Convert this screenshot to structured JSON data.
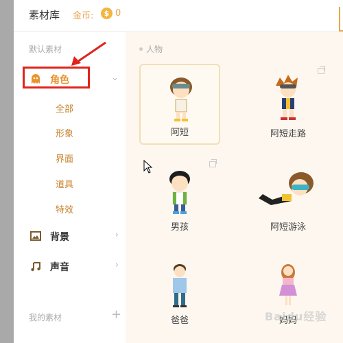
{
  "header": {
    "title": "素材库",
    "coin_label": "金币:",
    "coin_icon": "$",
    "coin_value": "0"
  },
  "sidebar": {
    "default_section": "默认素材",
    "my_section": "我的素材",
    "categories": [
      {
        "label": "角色",
        "icon": "ghost-icon",
        "active": true
      },
      {
        "label": "背景",
        "icon": "image-icon"
      },
      {
        "label": "声音",
        "icon": "music-note-icon"
      }
    ],
    "subcategories": [
      "全部",
      "形象",
      "界面",
      "道具",
      "特效"
    ]
  },
  "content": {
    "group_title": "人物",
    "items": [
      {
        "name": "阿短"
      },
      {
        "name": "阿短走路"
      },
      {
        "name": "男孩"
      },
      {
        "name": "阿短游泳"
      },
      {
        "name": "爸爸"
      },
      {
        "name": "妈妈"
      }
    ]
  },
  "watermark": "Baidu经验",
  "colors": {
    "accent": "#e8932e",
    "highlight": "#e0231b",
    "content_bg": "#fdf7ef"
  }
}
